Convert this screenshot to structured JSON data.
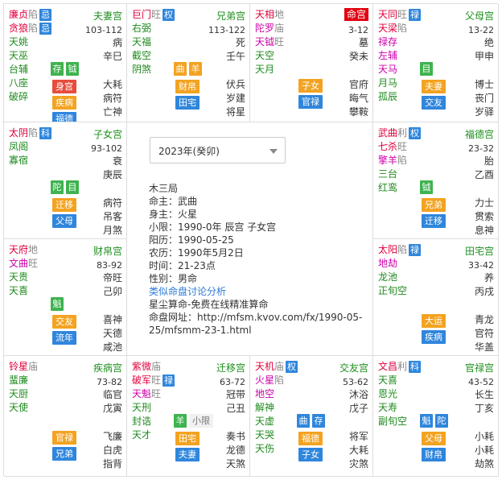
{
  "palaces": [
    {
      "major": [
        {
          "name": "廉贞",
          "bright": "陷",
          "hua": "忌",
          "color": "red"
        },
        {
          "name": "贪狼",
          "bright": "陷",
          "hua": "忌",
          "color": "red"
        }
      ],
      "minor": [
        "天姚",
        "天巫",
        "台辅",
        "八座",
        "破碎"
      ],
      "pname": "夫妻宫",
      "range": "103-112",
      "right": [
        "病",
        "辛巳"
      ],
      "right2": [
        "大耗",
        "病符",
        "亡神"
      ],
      "tags": [
        {
          "t": "存",
          "c": "green"
        },
        {
          "t": "钺",
          "c": "green"
        }
      ],
      "tags2": [
        {
          "t": "身宫",
          "c": "red"
        },
        {
          "t": "疾病",
          "c": "orange"
        },
        {
          "t": "福德",
          "c": "blue"
        }
      ]
    },
    {
      "major": [
        {
          "name": "巨门",
          "bright": "旺",
          "hua": "权",
          "color": "red"
        },
        {
          "name": "右弼",
          "bright": "",
          "hua": "",
          "color": "green"
        },
        {
          "name": "天福",
          "bright": "",
          "hua": "",
          "color": "green"
        },
        {
          "name": "截空",
          "bright": "",
          "hua": "",
          "color": "green"
        },
        {
          "name": "阴煞",
          "bright": "",
          "hua": "",
          "color": "green"
        }
      ],
      "minor": [],
      "pname": "兄弟宫",
      "range": "113-122",
      "right": [
        "死",
        "壬午"
      ],
      "right2": [
        "伏兵",
        "岁建",
        "将星"
      ],
      "tags": [
        {
          "t": "曲",
          "c": "orange"
        },
        {
          "t": "羊",
          "c": "orange"
        }
      ],
      "tags2": [
        {
          "t": "财帛",
          "c": "orange"
        },
        {
          "t": "田宅",
          "c": "blue"
        }
      ]
    },
    {
      "major": [
        {
          "name": "天相",
          "bright": "地",
          "hua": "",
          "color": "red"
        },
        {
          "name": "陀罗",
          "bright": "庙",
          "hua": "",
          "color": "pink"
        },
        {
          "name": "天钺",
          "bright": "旺",
          "hua": "",
          "color": "pink"
        }
      ],
      "minor": [
        "天空",
        "天月"
      ],
      "pname": "命宫",
      "range": "3-12",
      "right": [
        "墓",
        "癸未"
      ],
      "right2": [
        "官府",
        "晦气",
        "攀鞍"
      ],
      "tags": [],
      "tags2": [
        {
          "t": "子女",
          "c": "orange"
        },
        {
          "t": "官禄",
          "c": "blue"
        }
      ]
    },
    {
      "major": [
        {
          "name": "天同",
          "bright": "旺",
          "hua": "禄",
          "color": "red"
        },
        {
          "name": "天梁",
          "bright": "陷",
          "hua": "",
          "color": "red"
        },
        {
          "name": "禄存",
          "bright": "",
          "hua": "",
          "color": "pink"
        },
        {
          "name": "左辅",
          "bright": "",
          "hua": "",
          "color": "pink"
        },
        {
          "name": "天马",
          "bright": "",
          "hua": "",
          "color": "pink"
        }
      ],
      "minor": [
        "月马",
        "孤辰"
      ],
      "pname": "父母宫",
      "range": "13-22",
      "right": [
        "绝",
        "甲申"
      ],
      "right2": [
        "博士",
        "丧门",
        "岁驿"
      ],
      "tags": [
        {
          "t": "目",
          "c": "green"
        }
      ],
      "tags2": [
        {
          "t": "夫妻",
          "c": "orange"
        },
        {
          "t": "交友",
          "c": "blue"
        }
      ]
    },
    {
      "major": [
        {
          "name": "太阴",
          "bright": "陷",
          "hua": "科",
          "color": "red"
        }
      ],
      "minor": [
        "凤阁",
        "寡宿"
      ],
      "pname": "子女宫",
      "range": "93-102",
      "right": [
        "衰",
        "庚辰"
      ],
      "right2": [
        "病符",
        "吊客",
        "月煞"
      ],
      "tags": [
        {
          "t": "陀",
          "c": "green"
        },
        {
          "t": "目",
          "c": "green"
        }
      ],
      "tags2": [
        {
          "t": "迁移",
          "c": "orange"
        },
        {
          "t": "父母",
          "c": "blue"
        }
      ]
    },
    {
      "major": [
        {
          "name": "武曲",
          "bright": "利",
          "hua": "权",
          "color": "red"
        },
        {
          "name": "七杀",
          "bright": "旺",
          "hua": "",
          "color": "red"
        },
        {
          "name": "擎羊",
          "bright": "陷",
          "hua": "",
          "color": "pink"
        }
      ],
      "minor": [
        "三台",
        "红鸾"
      ],
      "pname": "福德宫",
      "range": "23-32",
      "right": [
        "胎",
        "乙酉"
      ],
      "right2": [
        "力士",
        "贯索",
        "息神"
      ],
      "tags": [
        {
          "t": "钺",
          "c": "green"
        }
      ],
      "tags2": [
        {
          "t": "兄弟",
          "c": "orange"
        },
        {
          "t": "迁移",
          "c": "blue"
        }
      ]
    },
    {
      "major": [
        {
          "name": "天府",
          "bright": "地",
          "hua": "",
          "color": "red"
        },
        {
          "name": "文曲",
          "bright": "旺",
          "hua": "",
          "color": "pink"
        }
      ],
      "minor": [
        "天贵",
        "天喜"
      ],
      "pname": "财帛宫",
      "range": "83-92",
      "right": [
        "帝旺",
        "己卯"
      ],
      "right2": [
        "喜神",
        "天德",
        "咸池"
      ],
      "tags": [
        {
          "t": "魁",
          "c": "green"
        }
      ],
      "tags2": [
        {
          "t": "交友",
          "c": "orange"
        },
        {
          "t": "流年",
          "c": "blue"
        }
      ]
    },
    {
      "major": [
        {
          "name": "太阳",
          "bright": "陷",
          "hua": "禄",
          "color": "red"
        },
        {
          "name": "地劫",
          "bright": "",
          "hua": "",
          "color": "pink"
        }
      ],
      "minor": [
        "龙池",
        "正旬空"
      ],
      "pname": "田宅宫",
      "range": "33-42",
      "right": [
        "养",
        "丙戌"
      ],
      "right2": [
        "青龙",
        "官符",
        "华盖"
      ],
      "tags": [],
      "tags2": [
        {
          "t": "大运",
          "c": "orange"
        },
        {
          "t": "疾病",
          "c": "blue"
        }
      ]
    },
    {
      "major": [
        {
          "name": "铃星",
          "bright": "庙",
          "hua": "",
          "color": "red"
        }
      ],
      "minor": [
        "蜚廉",
        "天厨",
        "天使"
      ],
      "pname": "疾病宫",
      "range": "73-82",
      "right": [
        "临官",
        "戊寅"
      ],
      "right2": [
        "飞廉",
        "白虎",
        "指背"
      ],
      "tags": [],
      "tags2": [
        {
          "t": "官禄",
          "c": "orange"
        },
        {
          "t": "兄弟",
          "c": "blue"
        }
      ]
    },
    {
      "major": [
        {
          "name": "紫微",
          "bright": "庙",
          "hua": "",
          "color": "red"
        },
        {
          "name": "破军",
          "bright": "旺",
          "hua": "禄",
          "color": "red"
        },
        {
          "name": "天魁",
          "bright": "旺",
          "hua": "",
          "color": "pink"
        }
      ],
      "minor": [
        "天刑",
        "封诰",
        "天才"
      ],
      "pname": "迁移宫",
      "range": "63-72",
      "right": [
        "冠带",
        "己丑"
      ],
      "right2": [
        "奏书",
        "龙德",
        "天煞"
      ],
      "tags": [
        {
          "t": "羊",
          "c": "green"
        },
        {
          "t": "小限",
          "c": "gray"
        }
      ],
      "tags2": [
        {
          "t": "田宅",
          "c": "orange"
        },
        {
          "t": "夫妻",
          "c": "blue"
        }
      ]
    },
    {
      "major": [
        {
          "name": "天机",
          "bright": "庙",
          "hua": "权",
          "color": "red"
        },
        {
          "name": "火星",
          "bright": "陷",
          "hua": "",
          "color": "pink"
        },
        {
          "name": "地空",
          "bright": "",
          "hua": "",
          "color": "pink"
        }
      ],
      "minor": [
        "解神",
        "天虚",
        "天哭",
        "天伤"
      ],
      "pname": "交友宫",
      "range": "53-62",
      "right": [
        "沐浴",
        "戊子"
      ],
      "right2": [
        "将军",
        "大耗",
        "灾煞"
      ],
      "tags": [
        {
          "t": "曲",
          "c": "blue"
        },
        {
          "t": "存",
          "c": "blue"
        }
      ],
      "tags2": [
        {
          "t": "福德",
          "c": "orange"
        },
        {
          "t": "子女",
          "c": "blue"
        }
      ]
    },
    {
      "major": [
        {
          "name": "文昌",
          "bright": "利",
          "hua": "科",
          "color": "red"
        }
      ],
      "minor": [
        "天喜",
        "恩光",
        "天寿",
        "副旬空"
      ],
      "pname": "官禄宫",
      "range": "43-52",
      "right": [
        "长生",
        "丁亥"
      ],
      "right2": [
        "小耗",
        "小耗",
        "劫煞"
      ],
      "tags": [
        {
          "t": "魁",
          "c": "blue"
        },
        {
          "t": "陀",
          "c": "blue"
        }
      ],
      "tags2": [
        {
          "t": "父母",
          "c": "orange"
        },
        {
          "t": "财帛",
          "c": "blue"
        }
      ]
    }
  ],
  "center": {
    "year_selected": "2023年(癸卯)",
    "info": [
      "木三局",
      "命主：武曲",
      "身主：火星",
      "小限：1990-0年 辰宫 子女宫",
      "阳历：1990-05-25",
      "农历：1990年5月2日",
      "时间：21-23点",
      "性别：男命"
    ],
    "discuss_link": "类似命盘讨论分析",
    "site_name": "星尘算命-免费在线精准算命",
    "url_text": "命盘网址：http://mfsm.kvov.com/fx/1990-05-25/mfsmm-23-1.html"
  }
}
